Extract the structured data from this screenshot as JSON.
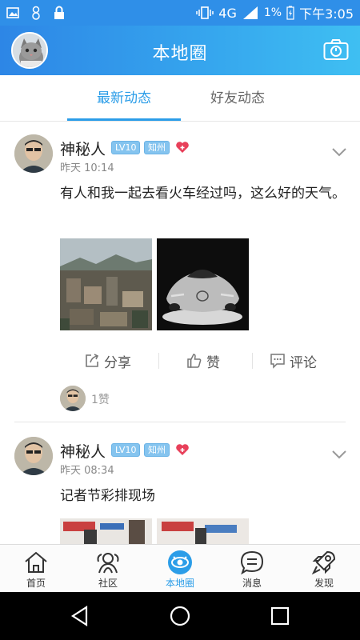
{
  "status_bar": {
    "network": "4G",
    "network_sup": "4G",
    "battery": "1%",
    "time": "下午3:05"
  },
  "header": {
    "title": "本地圈",
    "left_icon": "user-avatar",
    "right_icon": "camera-icon"
  },
  "tabs": [
    {
      "label": "最新动态",
      "active": true
    },
    {
      "label": "好友动态",
      "active": false
    }
  ],
  "posts": [
    {
      "name": "神秘人",
      "level": "LV10",
      "city": "知州",
      "time": "昨天 10:14",
      "text": "有人和我一起去看火车经过吗，这么好的天气。",
      "actions": {
        "share": "分享",
        "like": "赞",
        "comment": "评论"
      },
      "likes": "1赞"
    },
    {
      "name": "神秘人",
      "level": "LV10",
      "city": "知州",
      "time": "昨天 08:34",
      "text": "记者节彩排现场"
    }
  ],
  "bottom_nav": [
    {
      "label": "首页",
      "icon": "home-icon",
      "active": false
    },
    {
      "label": "社区",
      "icon": "community-icon",
      "active": false
    },
    {
      "label": "本地圈",
      "icon": "local-circle-icon",
      "active": true
    },
    {
      "label": "消息",
      "icon": "message-icon",
      "active": false
    },
    {
      "label": "发现",
      "icon": "rocket-icon",
      "active": false
    }
  ],
  "colors": {
    "accent": "#2b9de8",
    "header_start": "#2d86e6",
    "header_end": "#3fbff2",
    "badge": "#85c4ef",
    "heart": "#e8405a"
  }
}
